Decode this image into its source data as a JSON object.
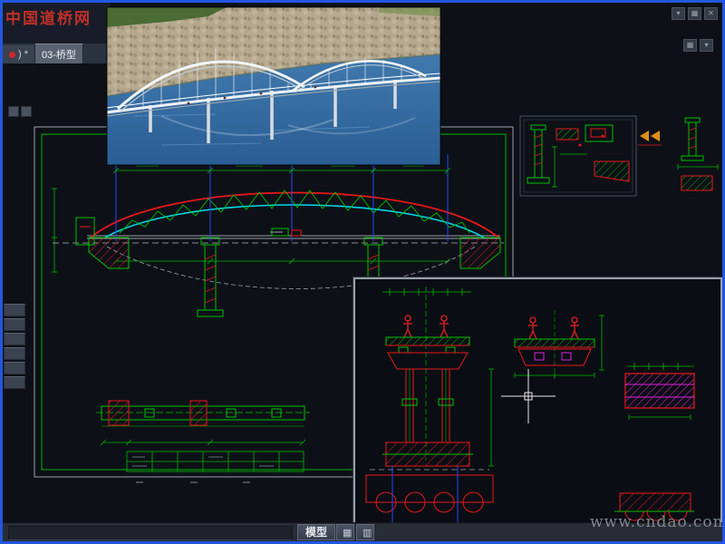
{
  "colors": {
    "window_border": "#2257e0",
    "canvas_bg": "#0d1117",
    "cad_green": "#00c000",
    "cad_red": "#e81818",
    "cad_cyan": "#00d8e8",
    "cad_blue": "#2846ff",
    "cad_magenta": "#e020e0",
    "watermark_red": "#c03028"
  },
  "header": {
    "watermark": "中国道桥网",
    "tabs": [
      {
        "label": ") *",
        "icon": "red-dot",
        "active": false
      },
      {
        "label": "03-桥型",
        "icon": "",
        "active": true
      }
    ],
    "window_icons": [
      "▾",
      "▦",
      "✕"
    ],
    "toolbar_icons": [
      "▦",
      "▾"
    ]
  },
  "statusbar": {
    "model_tab": "模型",
    "layout_icons": [
      "▦",
      "▥"
    ]
  },
  "watermark_site": "www.cndao.com"
}
